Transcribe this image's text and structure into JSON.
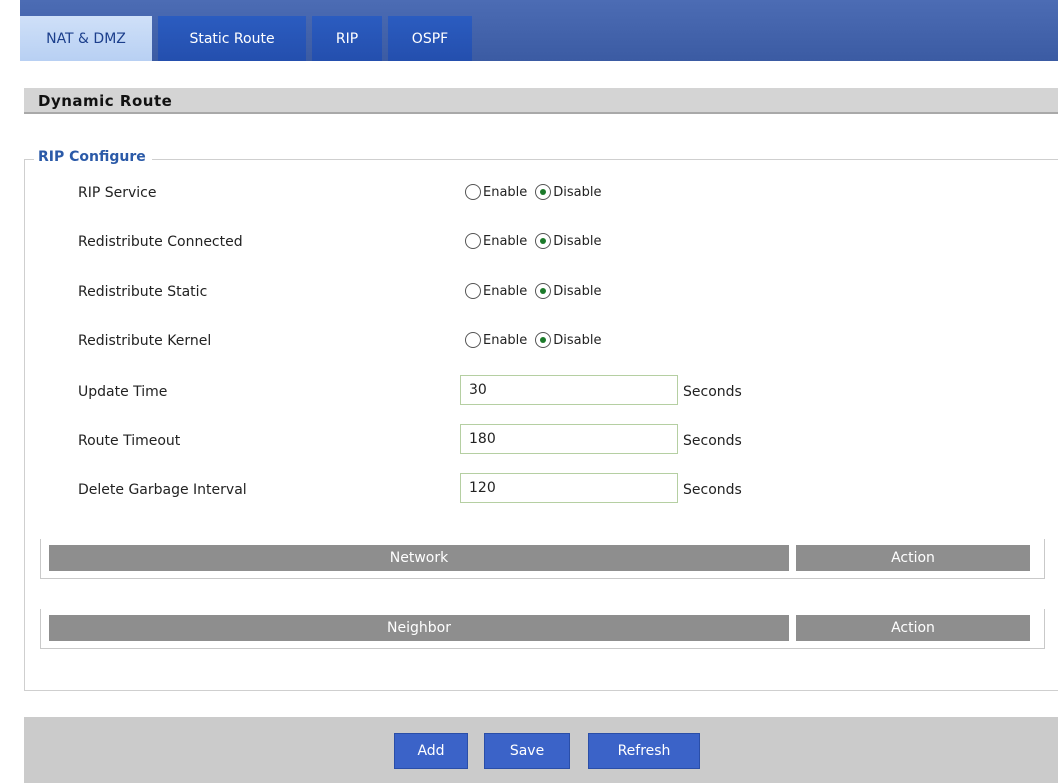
{
  "tabs": [
    {
      "label": "NAT & DMZ"
    },
    {
      "label": "Static Route"
    },
    {
      "label": "RIP"
    },
    {
      "label": "OSPF"
    }
  ],
  "section_title": "Dynamic Route",
  "fieldset_legend": "RIP Configure",
  "radio_rows": [
    {
      "label": "RIP Service",
      "enable": "Enable",
      "disable": "Disable",
      "selected": "Disable"
    },
    {
      "label": "Redistribute Connected",
      "enable": "Enable",
      "disable": "Disable",
      "selected": "Disable"
    },
    {
      "label": "Redistribute Static",
      "enable": "Enable",
      "disable": "Disable",
      "selected": "Disable"
    },
    {
      "label": "Redistribute Kernel",
      "enable": "Enable",
      "disable": "Disable",
      "selected": "Disable"
    }
  ],
  "input_rows": [
    {
      "label": "Update Time",
      "value": "30",
      "unit": "Seconds"
    },
    {
      "label": "Route Timeout",
      "value": "180",
      "unit": "Seconds"
    },
    {
      "label": "Delete Garbage Interval",
      "value": "120",
      "unit": "Seconds"
    }
  ],
  "network_table": {
    "col1": "Network",
    "col2": "Action"
  },
  "neighbor_table": {
    "col1": "Neighbor",
    "col2": "Action"
  },
  "buttons": {
    "add": "Add",
    "save": "Save",
    "refresh": "Refresh"
  }
}
